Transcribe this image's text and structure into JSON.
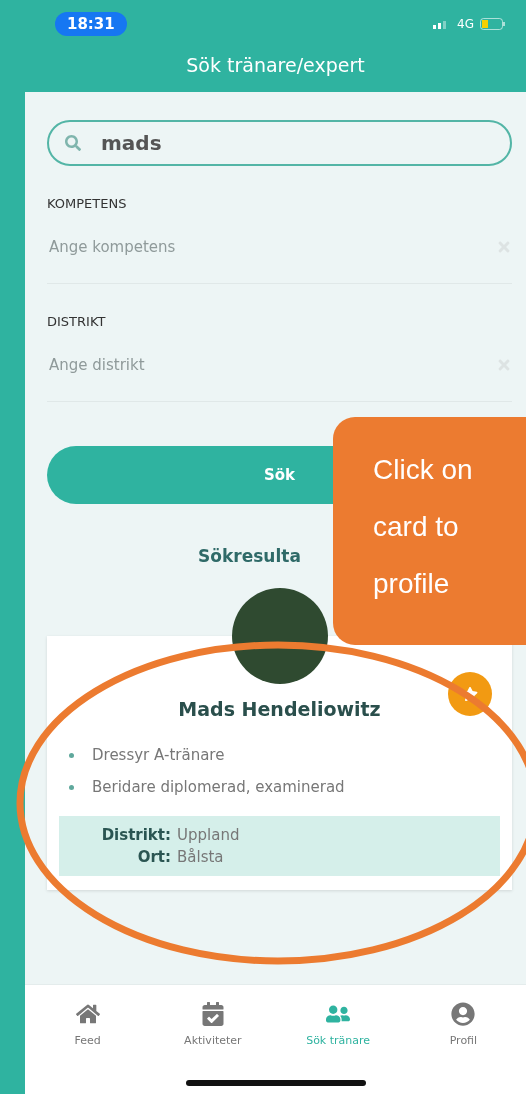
{
  "status_bar": {
    "time": "18:31",
    "network": "4G"
  },
  "header": {
    "title": "Sök tränare/expert"
  },
  "search": {
    "value": "mads"
  },
  "filters": [
    {
      "label": "KOMPETENS",
      "placeholder": "Ange kompetens"
    },
    {
      "label": "DISTRIKT",
      "placeholder": "Ange distrikt"
    }
  ],
  "search_button": "Sök",
  "results_title": "Sökresulta",
  "results": [
    {
      "name": "Mads Hendeliowitz",
      "favorite": true,
      "qualifications": [
        "Dressyr A-tränare",
        "Beridare diplomerad, examinerad"
      ],
      "details": [
        {
          "label": "Distrikt:",
          "value": "Uppland"
        },
        {
          "label": "Ort:",
          "value": "Bålsta"
        }
      ]
    }
  ],
  "nav": [
    {
      "label": "Feed",
      "kind": "home",
      "selected": false
    },
    {
      "label": "Aktiviteter",
      "kind": "calendar",
      "selected": false
    },
    {
      "label": "Sök tränare",
      "kind": "trainers",
      "selected": true
    },
    {
      "label": "Profil",
      "kind": "profile",
      "selected": false
    }
  ],
  "annotation": {
    "callout_lines": [
      "Click on",
      "card to",
      "profile"
    ]
  }
}
